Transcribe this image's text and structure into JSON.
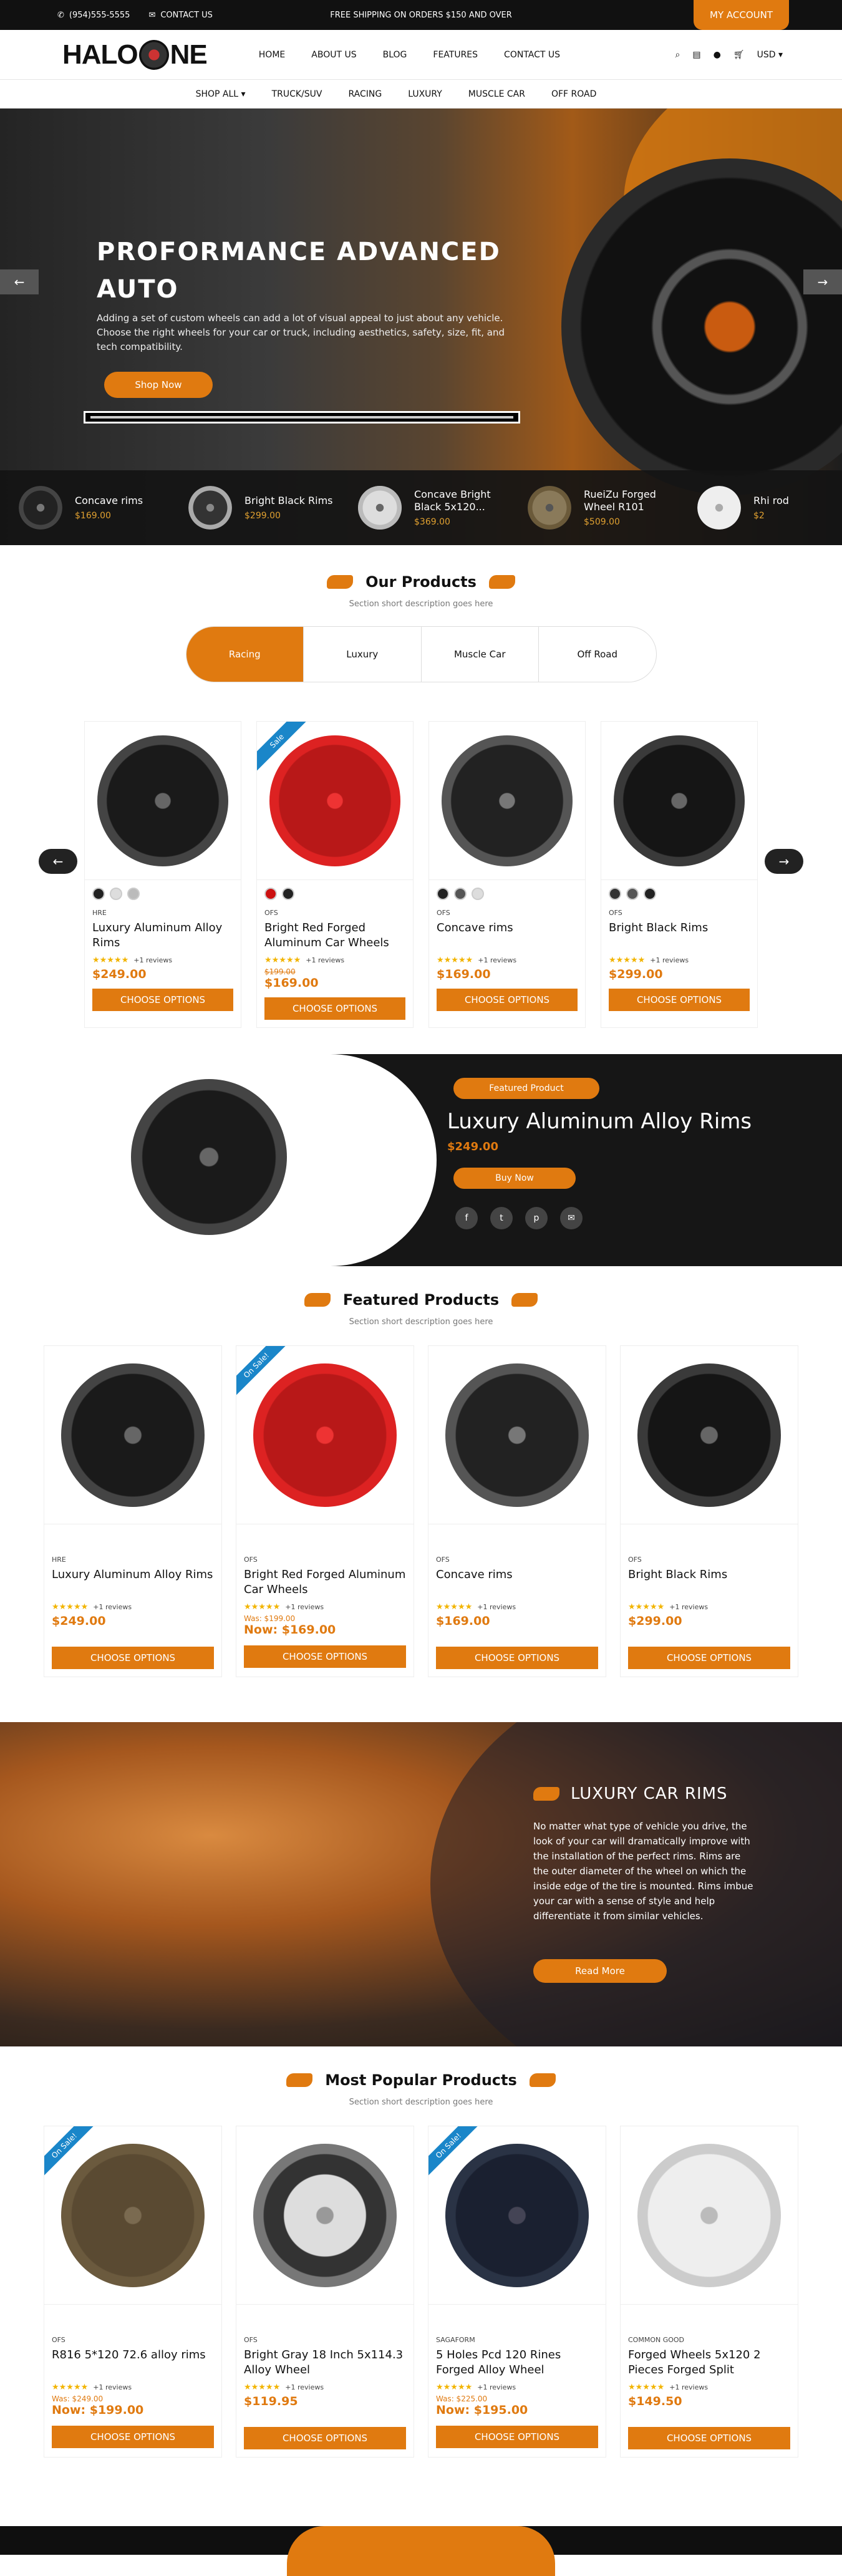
{
  "topbar": {
    "phone": "(954)555-5555",
    "contact": "CONTACT US",
    "announcement": "FREE SHIPPING ON ORDERS $150 AND OVER",
    "account": "MY ACCOUNT"
  },
  "header": {
    "logo_left": "HALO",
    "logo_right": "NE",
    "menu": [
      "HOME",
      "ABOUT US",
      "BLOG",
      "FEATURES",
      "CONTACT US"
    ],
    "currency": "USD"
  },
  "categories": [
    "SHOP ALL",
    "TRUCK/SUV",
    "RACING",
    "LUXURY",
    "MUSCLE CAR",
    "OFF ROAD"
  ],
  "hero": {
    "title": "PROFORMANCE ADVANCED AUTO",
    "text": "Adding a set of custom wheels can add a lot of visual appeal to just about any vehicle. Choose the right wheels for your car or truck, including aesthetics, safety, size, fit, and tech compatibility.",
    "button": "Shop Now"
  },
  "strip": [
    {
      "name": "Concave rims",
      "price": "$169.00"
    },
    {
      "name": "Bright Black Rims",
      "price": "$299.00"
    },
    {
      "name": "Concave Bright Black 5x120...",
      "price": "$369.00"
    },
    {
      "name": "RueiZu Forged Wheel R101",
      "price": "$509.00"
    },
    {
      "name": "Rhi rod",
      "price": "$2"
    }
  ],
  "our_products": {
    "title": "Our Products",
    "subtitle": "Section short description goes here",
    "tabs": [
      "Racing",
      "Luxury",
      "Muscle Car",
      "Off Road"
    ],
    "items": [
      {
        "brand": "HRE",
        "name": "Luxury Aluminum Alloy Rims",
        "reviews": "+1 reviews",
        "was": "",
        "price": "$249.00",
        "button": "CHOOSE OPTIONS",
        "ribbon": ""
      },
      {
        "brand": "OFS",
        "name": "Bright Red Forged Aluminum Car Wheels",
        "reviews": "+1 reviews",
        "was": "$199.00",
        "price": "$169.00",
        "button": "CHOOSE OPTIONS",
        "ribbon": "Sale"
      },
      {
        "brand": "OFS",
        "name": "Concave rims",
        "reviews": "+1 reviews",
        "was": "",
        "price": "$169.00",
        "button": "CHOOSE OPTIONS",
        "ribbon": ""
      },
      {
        "brand": "OFS",
        "name": "Bright Black Rims",
        "reviews": "+1 reviews",
        "was": "",
        "price": "$299.00",
        "button": "CHOOSE OPTIONS",
        "ribbon": ""
      }
    ]
  },
  "featured_product": {
    "tag": "Featured Product",
    "name": "Luxury Aluminum Alloy Rims",
    "price": "$249.00",
    "button": "Buy Now"
  },
  "featured_products": {
    "title": "Featured Products",
    "subtitle": "Section short description goes here",
    "items": [
      {
        "brand": "HRE",
        "name": "Luxury Aluminum Alloy Rims",
        "reviews": "+1 reviews",
        "was": "",
        "price": "$249.00",
        "button": "CHOOSE OPTIONS",
        "ribbon": ""
      },
      {
        "brand": "OFS",
        "name": "Bright Red Forged Aluminum Car Wheels",
        "reviews": "+1 reviews",
        "was": "Was: $199.00",
        "price": "Now: $169.00",
        "button": "CHOOSE OPTIONS",
        "ribbon": "On Sale!"
      },
      {
        "brand": "OFS",
        "name": "Concave rims",
        "reviews": "+1 reviews",
        "was": "",
        "price": "$169.00",
        "button": "CHOOSE OPTIONS",
        "ribbon": ""
      },
      {
        "brand": "OFS",
        "name": "Bright Black Rims",
        "reviews": "+1 reviews",
        "was": "",
        "price": "$299.00",
        "button": "CHOOSE OPTIONS",
        "ribbon": ""
      }
    ]
  },
  "banner": {
    "title": "LUXURY CAR RIMS",
    "text": "No matter what type of vehicle you drive, the look of your car will dramatically improve with the installation of the perfect rims. Rims are the outer diameter of the wheel on which the inside edge of the tire is mounted. Rims imbue your car with a sense of style and help differentiate it from similar vehicles.",
    "button": "Read More"
  },
  "popular": {
    "title": "Most Popular Products",
    "subtitle": "Section short description goes here",
    "items": [
      {
        "brand": "OFS",
        "name": "R816 5*120 72.6 alloy rims",
        "reviews": "+1 reviews",
        "was": "Was: $249.00",
        "price": "Now: $199.00",
        "button": "CHOOSE OPTIONS",
        "ribbon": "On Sale!"
      },
      {
        "brand": "OFS",
        "name": "Bright Gray 18 Inch 5x114.3 Alloy Wheel",
        "reviews": "+1 reviews",
        "was": "",
        "price": "$119.95",
        "button": "CHOOSE OPTIONS",
        "ribbon": ""
      },
      {
        "brand": "SAGAFORM",
        "name": "5 Holes Pcd 120 Rines Forged Alloy Wheel",
        "reviews": "+1 reviews",
        "was": "Was: $225.00",
        "price": "Now: $195.00",
        "button": "CHOOSE OPTIONS",
        "ribbon": "On Sale!"
      },
      {
        "brand": "COMMON GOOD",
        "name": "Forged Wheels 5x120 2 Pieces Forged Split",
        "reviews": "+1 reviews",
        "was": "",
        "price": "$149.50",
        "button": "CHOOSE OPTIONS",
        "ribbon": ""
      }
    ]
  },
  "colors": {
    "accent": "#e07a10",
    "dark": "#111111",
    "sale_ribbon": "#1a86c9"
  }
}
